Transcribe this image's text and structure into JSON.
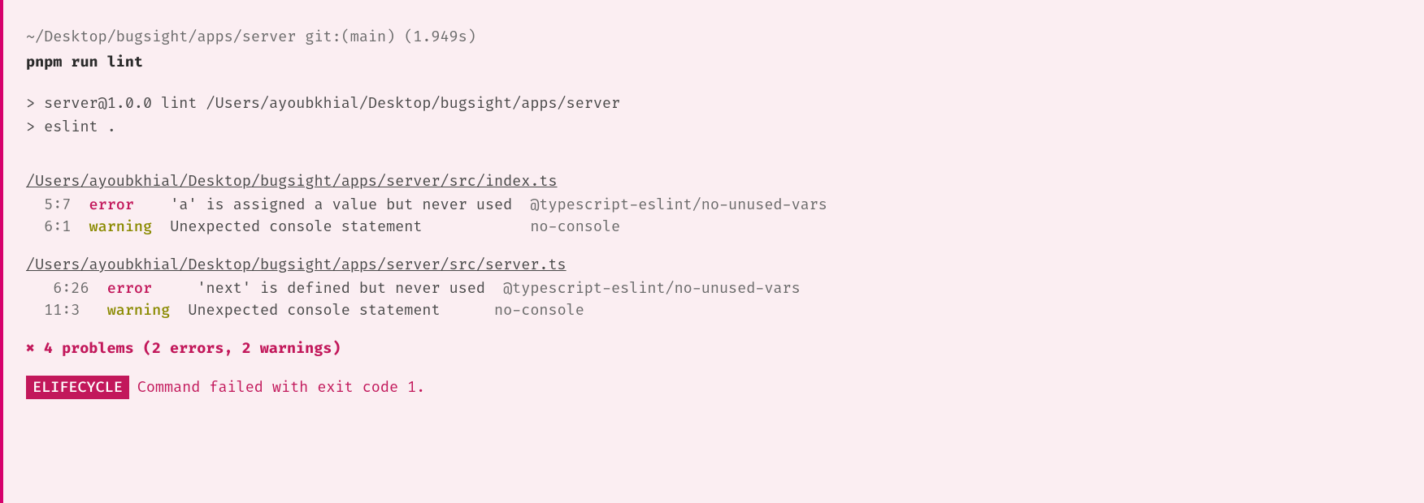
{
  "prompt": "~/Desktop/bugsight/apps/server git:(main) (1.949s)",
  "command": "pnpm run lint",
  "scriptLines": [
    "> server@1.0.0 lint /Users/ayoubkhial/Desktop/bugsight/apps/server",
    "> eslint ."
  ],
  "files": [
    {
      "path": "/Users/ayoubkhial/Desktop/bugsight/apps/server/src/index.ts",
      "issues": [
        {
          "loc": "  5:7",
          "sev": "error",
          "sevPad": "error  ",
          "msg": "'a' is assigned a value but never used  ",
          "rule": "@typescript-eslint/no-unused-vars"
        },
        {
          "loc": "  6:1",
          "sev": "warning",
          "sevPad": "warning",
          "msg": "Unexpected console statement            ",
          "rule": "no-console"
        }
      ]
    },
    {
      "path": "/Users/ayoubkhial/Desktop/bugsight/apps/server/src/server.ts",
      "issues": [
        {
          "loc": "   6:26",
          "sev": "error",
          "sevPad": "error  ",
          "msg": "'next' is defined but never used  ",
          "rule": "@typescript-eslint/no-unused-vars"
        },
        {
          "loc": "  11:3 ",
          "sev": "warning",
          "sevPad": "warning",
          "msg": "Unexpected console statement      ",
          "rule": "no-console"
        }
      ]
    }
  ],
  "summaryX": "✖",
  "summaryText": " 4 problems (2 errors, 2 warnings)",
  "lifecycleBadge": "ELIFECYCLE",
  "lifecycleMsg": "Command failed with exit code 1."
}
